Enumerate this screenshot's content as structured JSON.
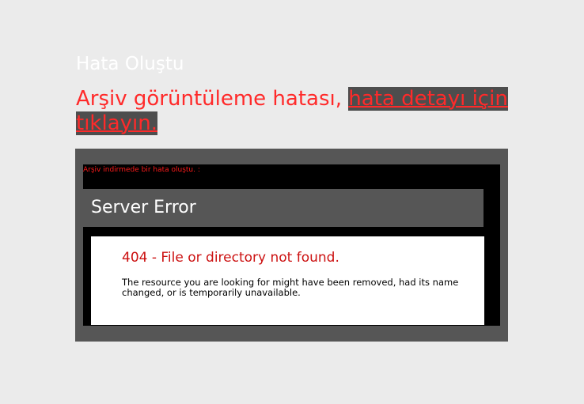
{
  "page": {
    "title": "Hata Oluştu",
    "message_prefix": "Arşiv görüntüleme hatası, ",
    "detail_link": "hata detayı için tıklayın."
  },
  "error_panel": {
    "download_message": "Arşiv indirmede bir hata oluştu. :",
    "header": "Server Error",
    "error_title": "404 - File or directory not found.",
    "error_description": "The resource you are looking for might have been removed, had its name changed, or is temporarily unavailable."
  },
  "colors": {
    "background": "#ebebeb",
    "error_red": "#ff2a2a",
    "panel_gray": "#565656",
    "server_error_red": "#cc1111"
  }
}
